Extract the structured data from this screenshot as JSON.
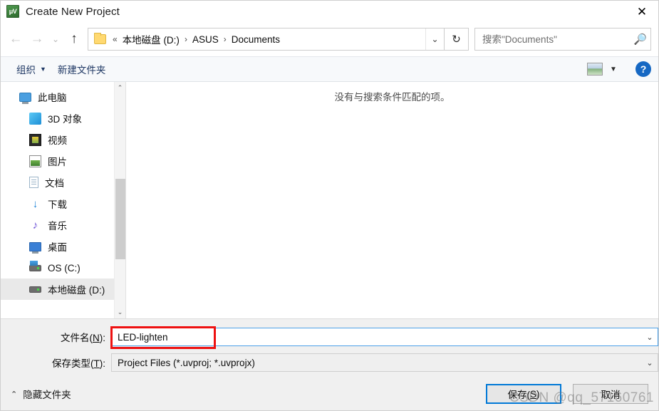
{
  "window": {
    "title": "Create New Project",
    "app_icon": "uvision-icon",
    "close_label": "✕"
  },
  "nav": {
    "back": "←",
    "forward": "→",
    "recent": "⌄",
    "up": "↑",
    "refresh": "↻",
    "dropdown": "⌄"
  },
  "address": {
    "chevrons": "«",
    "crumbs": [
      {
        "label": "本地磁盘 (D:)"
      },
      {
        "label": "ASUS"
      },
      {
        "label": "Documents"
      }
    ],
    "separator": "›"
  },
  "search": {
    "placeholder": "搜索\"Documents\"",
    "value": "",
    "icon": "search-icon"
  },
  "toolbar": {
    "organize_label": "组织",
    "organize_caret": "▼",
    "new_folder_label": "新建文件夹",
    "view_caret": "▼",
    "help_label": "?"
  },
  "sidebar": {
    "items": [
      {
        "label": "此电脑",
        "icon": "computer-icon",
        "level": 0,
        "selected": false
      },
      {
        "label": "3D 对象",
        "icon": "3d-objects-icon",
        "level": 1,
        "selected": false
      },
      {
        "label": "视频",
        "icon": "videos-icon",
        "level": 1,
        "selected": false
      },
      {
        "label": "图片",
        "icon": "pictures-icon",
        "level": 1,
        "selected": false
      },
      {
        "label": "文档",
        "icon": "documents-icon",
        "level": 1,
        "selected": false
      },
      {
        "label": "下载",
        "icon": "downloads-icon",
        "level": 1,
        "selected": false
      },
      {
        "label": "音乐",
        "icon": "music-icon",
        "level": 1,
        "selected": false
      },
      {
        "label": "桌面",
        "icon": "desktop-icon",
        "level": 1,
        "selected": false
      },
      {
        "label": "OS (C:)",
        "icon": "os-drive-icon",
        "level": 1,
        "selected": false
      },
      {
        "label": "本地磁盘 (D:)",
        "icon": "local-drive-icon",
        "level": 1,
        "selected": true
      }
    ],
    "scroll_up": "⌃",
    "scroll_down": "⌄"
  },
  "filelist": {
    "empty_message": "没有与搜索条件匹配的项。"
  },
  "form": {
    "filename_label_pre": "文件名(",
    "filename_label_key": "N",
    "filename_label_post": "):",
    "filename_value": "LED-lighten",
    "filetype_label_pre": "保存类型(",
    "filetype_label_key": "T",
    "filetype_label_post": "):",
    "filetype_value": "Project Files (*.uvproj; *.uvprojx)",
    "combo_arrow": "⌄"
  },
  "footer": {
    "hide_folders_caret": "⌃",
    "hide_folders_label": "隐藏文件夹",
    "save_label_pre": "保存(",
    "save_label_key": "S",
    "save_label_post": ")",
    "cancel_label": "取消"
  },
  "watermark": {
    "text": "CSDN @qq_57160761"
  },
  "colors": {
    "accent": "#0078d7",
    "toolbar_text": "#1f3864",
    "annotation_red": "#ee1111",
    "help_blue": "#1668c3"
  }
}
